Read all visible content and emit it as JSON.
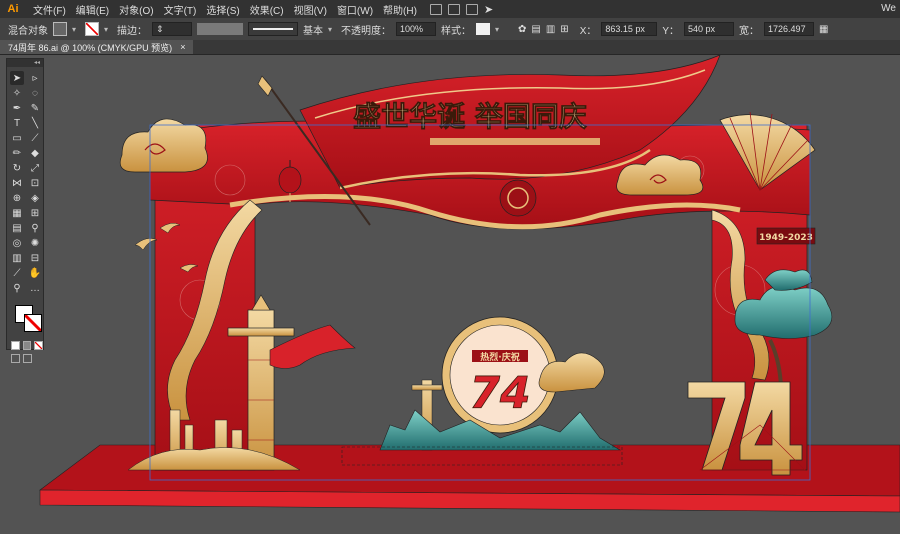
{
  "app": {
    "logo": "Ai"
  },
  "menu": {
    "items": [
      "文件(F)",
      "编辑(E)",
      "对象(O)",
      "文字(T)",
      "选择(S)",
      "效果(C)",
      "视图(V)",
      "窗口(W)",
      "帮助(H)"
    ],
    "right_text": "We"
  },
  "control_bar": {
    "selection_label": "混合对象",
    "stroke_label": "描边：",
    "stroke_style": "基本",
    "opacity_label": "不透明度：",
    "opacity_value": "100%",
    "style_label": "样式：",
    "x_label": "X：",
    "x_value": "863.15 px",
    "y_label": "Y：",
    "y_value": "540 px",
    "w_label": "宽：",
    "w_value": "1726.497"
  },
  "document_tab": {
    "title": "74周年 86.ai @ 100% (CMYK/GPU 预览)",
    "close_glyph": "×"
  },
  "artwork": {
    "title_text": "盛世华诞 举国同庆",
    "number_text": "74",
    "badge_text": "热烈·庆祝",
    "side_tag_text": "1949-2023"
  },
  "colors": {
    "red": "#c8161d",
    "dark_red": "#8e0e13",
    "gold": "#e8c07a",
    "teal": "#3e9e9a",
    "canvas_bg": "#535353"
  }
}
